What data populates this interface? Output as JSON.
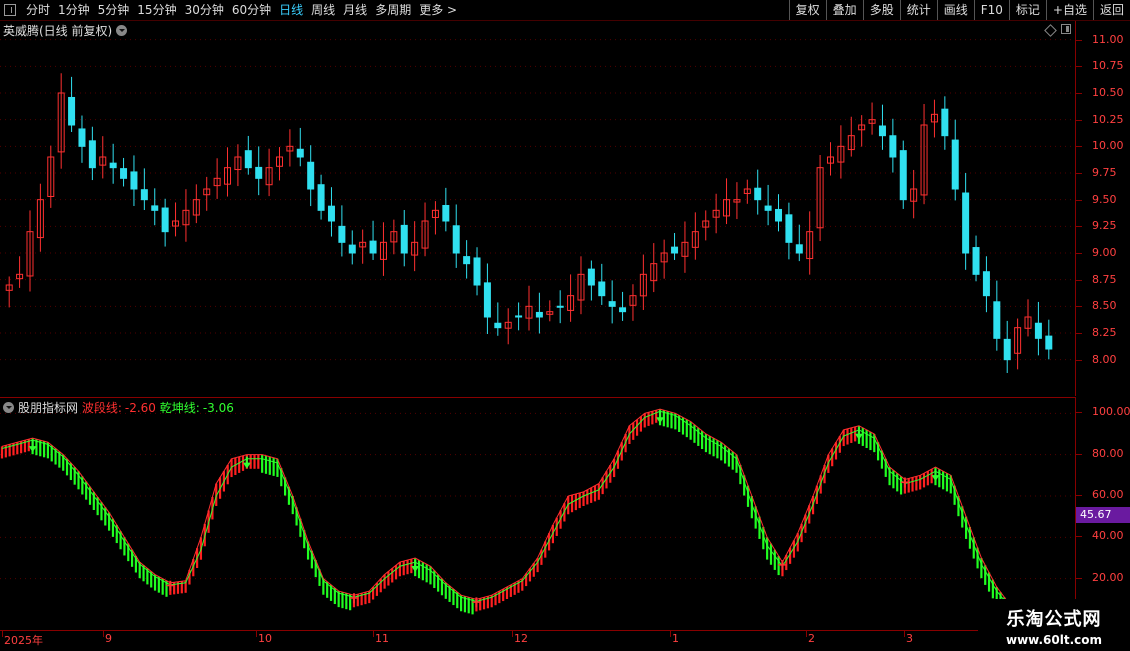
{
  "toolbar": {
    "tabs": [
      "分时",
      "1分钟",
      "5分钟",
      "15分钟",
      "30分钟",
      "60分钟",
      "日线",
      "周线",
      "月线",
      "多周期",
      "更多"
    ],
    "active_tab": "日线",
    "right_tabs": [
      "复权",
      "叠加",
      "多股",
      "统计",
      "画线",
      "F10",
      "+自选",
      "返回"
    ],
    "right_tab_labels": [
      "复权",
      "叠加",
      "多股",
      "统计",
      "画线",
      "F10",
      "标记",
      "+自选",
      "返回"
    ]
  },
  "price_panel": {
    "title": "英威腾(日线 前复权)"
  },
  "indicator_panel": {
    "name": "股朋指标网",
    "line1_label": "波段线:",
    "line1_value": "-2.60",
    "line2_label": "乾坤线:",
    "line2_value": "-3.06",
    "current_value": "45.67"
  },
  "watermark": {
    "line1": "乐淘公式网",
    "line2": "www.60lt.com"
  },
  "colors": {
    "up": "#ff3030",
    "down": "#30e0f0",
    "wave_up": "#ff2020",
    "wave_down": "#20ff20",
    "axis": "#ff4040"
  },
  "chart_data": [
    {
      "type": "candlestick",
      "title": "英威腾(日线 前复权)",
      "ylim": [
        7.8,
        11.1
      ],
      "yticks": [
        "11.00",
        "10.75",
        "10.50",
        "10.25",
        "10.00",
        "9.75",
        "9.50",
        "9.25",
        "9.00",
        "8.75",
        "8.50",
        "8.25",
        "8.00"
      ],
      "close_series": [
        8.7,
        8.8,
        9.2,
        9.5,
        9.9,
        10.5,
        10.2,
        10.0,
        9.8,
        9.9,
        9.8,
        9.7,
        9.6,
        9.5,
        9.4,
        9.2,
        9.3,
        9.4,
        9.5,
        9.6,
        9.7,
        9.8,
        9.9,
        9.8,
        9.7,
        9.8,
        9.9,
        10.0,
        9.9,
        9.6,
        9.4,
        9.3,
        9.1,
        9.0,
        9.1,
        9.0,
        9.1,
        9.2,
        9.0,
        9.1,
        9.3,
        9.4,
        9.3,
        9.0,
        8.9,
        8.7,
        8.4,
        8.3,
        8.35,
        8.4,
        8.5,
        8.4,
        8.45,
        8.5,
        8.6,
        8.8,
        8.7,
        8.6,
        8.5,
        8.45,
        8.6,
        8.8,
        8.9,
        9.0,
        9.0,
        9.1,
        9.2,
        9.3,
        9.4,
        9.5,
        9.5,
        9.6,
        9.5,
        9.4,
        9.3,
        9.1,
        9.0,
        9.2,
        9.8,
        9.9,
        10.0,
        10.1,
        10.2,
        10.25,
        10.1,
        9.9,
        9.5,
        9.6,
        10.2,
        10.3,
        10.1,
        9.6,
        9.0,
        8.8,
        8.6,
        8.2,
        8.0,
        8.3,
        8.4,
        8.2,
        8.1
      ]
    },
    {
      "type": "line",
      "ylim": [
        0,
        105
      ],
      "yticks": [
        "100.00",
        "80.00",
        "60.00",
        "40.00",
        "20.00"
      ],
      "series": [
        {
          "name": "波段线",
          "values": [
            84,
            86,
            88,
            86,
            80,
            72,
            62,
            52,
            40,
            28,
            22,
            18,
            19,
            40,
            66,
            78,
            80,
            80,
            78,
            60,
            38,
            20,
            14,
            12,
            14,
            22,
            28,
            30,
            26,
            18,
            12,
            10,
            12,
            16,
            20,
            30,
            46,
            60,
            62,
            66,
            78,
            94,
            100,
            102,
            100,
            96,
            90,
            86,
            80,
            60,
            40,
            28,
            42,
            60,
            80,
            92,
            94,
            90,
            74,
            68,
            70,
            74,
            70,
            50,
            30,
            16,
            6
          ]
        },
        {
          "name": "乾坤线",
          "values": [
            83,
            85,
            87,
            85,
            79,
            70,
            60,
            50,
            38,
            27,
            21,
            17,
            18,
            34,
            60,
            74,
            78,
            78,
            76,
            58,
            36,
            19,
            13,
            11,
            13,
            20,
            26,
            28,
            24,
            17,
            11,
            9,
            11,
            15,
            19,
            28,
            42,
            56,
            60,
            63,
            74,
            90,
            98,
            101,
            99,
            94,
            88,
            84,
            78,
            56,
            36,
            26,
            38,
            56,
            76,
            89,
            92,
            88,
            72,
            66,
            68,
            72,
            68,
            46,
            27,
            14,
            5
          ]
        }
      ]
    }
  ],
  "x_axis": {
    "labels": [
      "2025年",
      "9",
      "10",
      "11",
      "12",
      "1",
      "2",
      "3"
    ]
  }
}
